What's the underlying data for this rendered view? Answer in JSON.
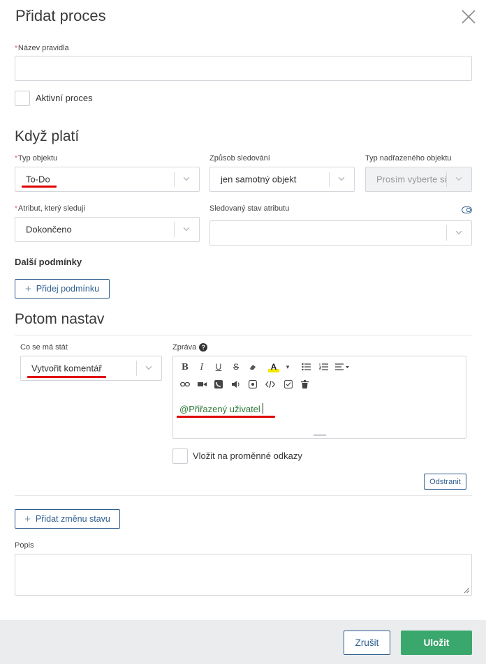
{
  "dialog": {
    "title": "Přidat proces",
    "close_icon": "close-icon"
  },
  "rule_name": {
    "required_mark": "*",
    "label": "Název pravidla",
    "value": ""
  },
  "active_process": {
    "label": "Aktivní proces",
    "checked": false
  },
  "when_section": {
    "title": "Když platí",
    "object_type": {
      "required_mark": "*",
      "label": "Typ objektu",
      "value": "To-Do"
    },
    "tracking_mode": {
      "label": "Způsob sledování",
      "value": "jen samotný objekt"
    },
    "parent_type": {
      "label": "Typ nadřazeného objektu",
      "value": "Prosím vyberte si"
    },
    "attribute": {
      "required_mark": "*",
      "label": "Atribut, který sleduji",
      "value": "Dokončeno"
    },
    "attribute_state": {
      "label": "Sledovaný stav atributu",
      "value": ""
    },
    "more_conditions_title": "Další podmínky",
    "add_condition_label": "Přidej podmínku"
  },
  "then_section": {
    "title": "Potom nastav",
    "action": {
      "label": "Co se má stát",
      "value": "Vytvořit komentář"
    },
    "message": {
      "label": "Zpráva",
      "help_icon": "?",
      "content": "@Přiřazený uživatel",
      "toolbar_row1": [
        "B",
        "I",
        "U",
        "S",
        "eraser-icon",
        "A",
        "▾",
        "bullet-list-icon",
        "numbered-list-icon",
        "align-icon"
      ],
      "toolbar_row2": [
        "link-icon",
        "video-icon",
        "phone-icon",
        "audio-icon",
        "embed-icon",
        "code-icon",
        "checkbox-icon",
        "trash-icon"
      ]
    },
    "insert_links_label": "Vložit na proměnné odkazy",
    "remove_label": "Odstranit",
    "add_state_change_label": "Přidat změnu stavu"
  },
  "description": {
    "label": "Popis",
    "value": ""
  },
  "footer": {
    "cancel_label": "Zrušit",
    "save_label": "Uložit"
  },
  "colors": {
    "accent": "#2e5f8f",
    "save_button": "#3aa76d",
    "annotation_red": "#e00000",
    "mention_green": "#2f7a3a"
  }
}
